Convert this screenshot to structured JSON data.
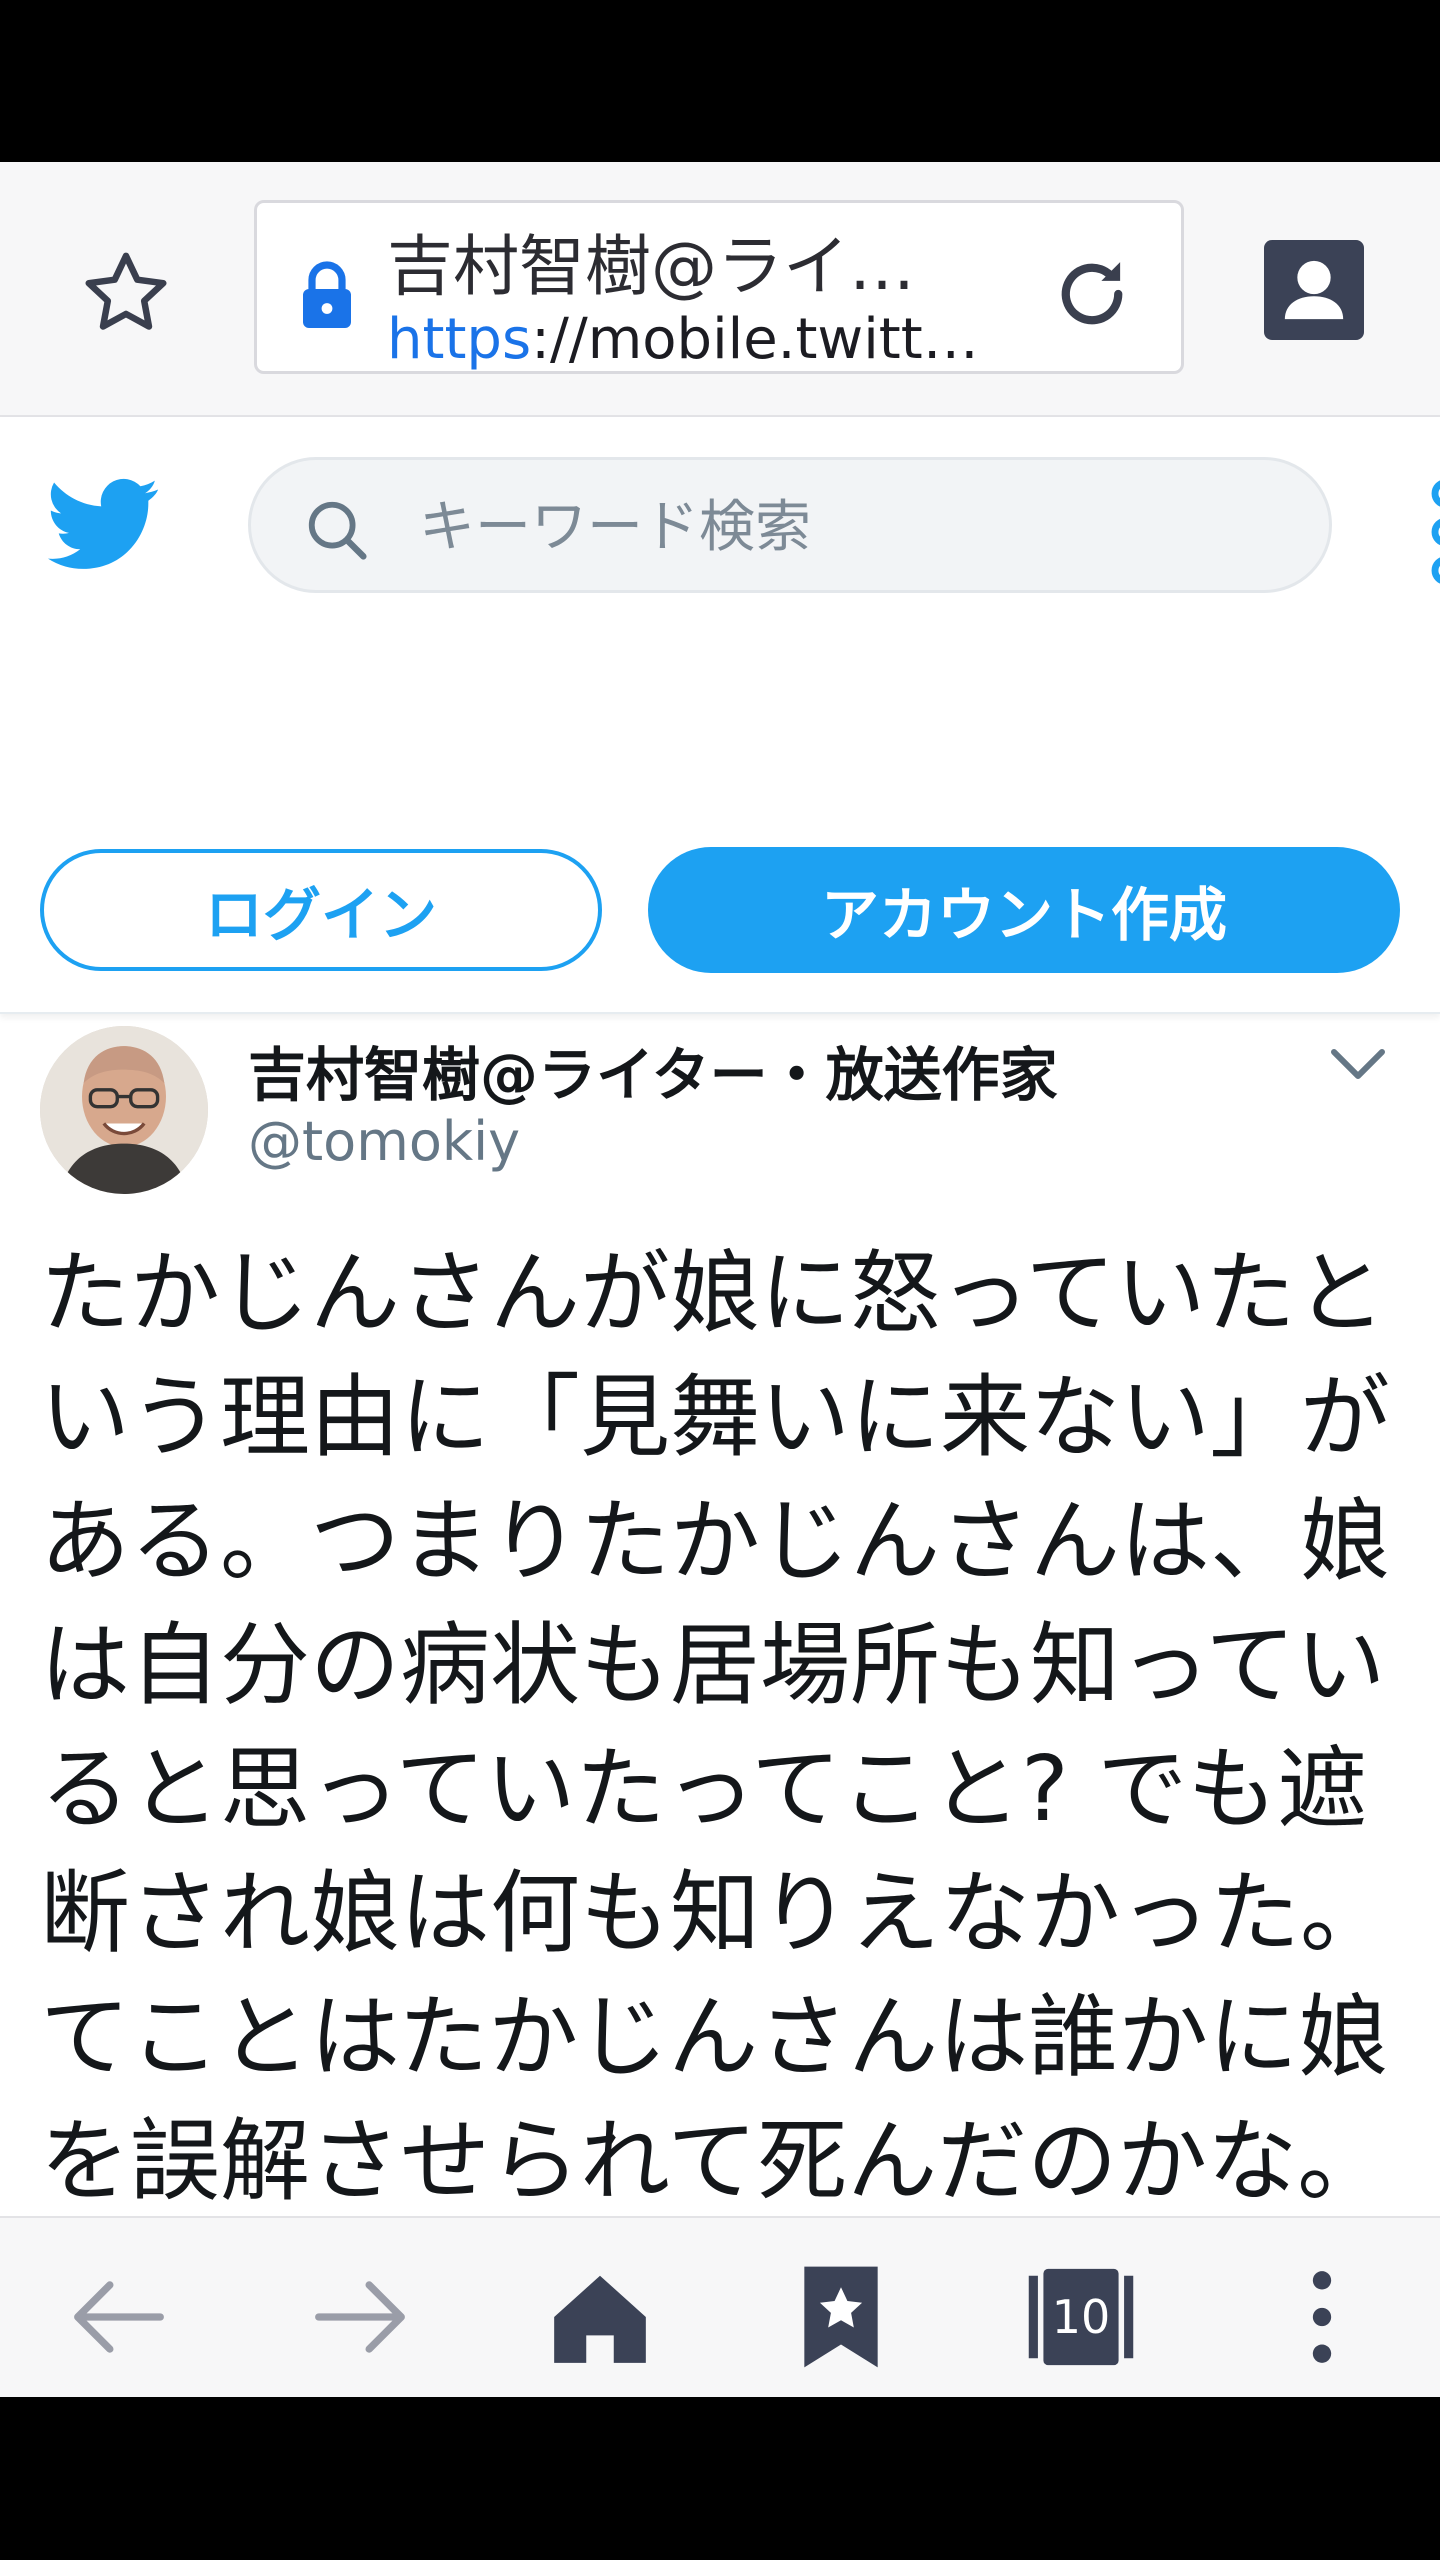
{
  "browser": {
    "page_title": "吉村智樹@ライ…",
    "url_scheme": "https",
    "url_rest": "://mobile.twitt…",
    "tabs_count": "10"
  },
  "twitter_header": {
    "search_placeholder": "キーワード検索",
    "login_label": "ログイン",
    "signup_label": "アカウント作成"
  },
  "tweet": {
    "display_name": "吉村智樹@ライター・放送作家",
    "handle": "@tomokiy",
    "text": "たかじんさんが娘に怒っていたという理由に「見舞いに来ない」がある。つまりたかじんさんは、娘は自分の病状も居場所も知っていると思っていたってこと? でも遮断され娘は何も知りえなかった。てことはたかじんさんは誰かに娘を誤解させられて死んだのかな。"
  },
  "colors": {
    "twitter_blue": "#1da1f2",
    "nav_dark": "#3b4256",
    "text_primary": "#14171a",
    "text_secondary": "#657786"
  },
  "icons": [
    "star-icon",
    "lock-icon",
    "reload-icon",
    "profile-icon",
    "twitter-bird-icon",
    "search-icon",
    "more-dots-icon",
    "chevron-down-icon",
    "back-arrow-icon",
    "forward-arrow-icon",
    "home-icon",
    "bookmark-star-icon",
    "tabs-icon",
    "overflow-menu-icon"
  ]
}
